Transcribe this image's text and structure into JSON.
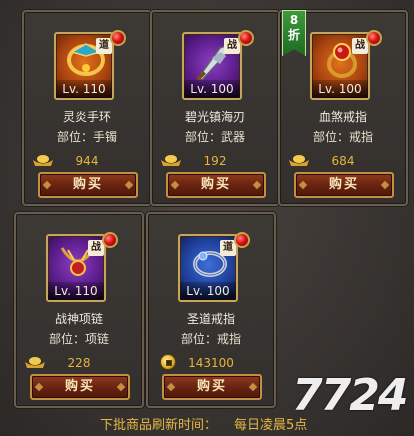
{
  "shop": {
    "items": [
      {
        "name": "灵炎手环",
        "level": "Lv. 110",
        "slot": "部位：手镯",
        "price": "944",
        "currency": "gold-ingot",
        "badge": "道",
        "frame": "orange",
        "buy_label": "购买"
      },
      {
        "name": "碧光镇海刃",
        "level": "Lv. 100",
        "slot": "部位：武器",
        "price": "192",
        "currency": "gold-ingot",
        "badge": "战",
        "frame": "purple",
        "buy_label": "购买"
      },
      {
        "name": "血煞戒指",
        "level": "Lv. 100",
        "slot": "部位：戒指",
        "price": "684",
        "currency": "gold-ingot",
        "badge": "战",
        "frame": "orange",
        "buy_label": "购买",
        "discount": "8\n折"
      },
      {
        "name": "战神项链",
        "level": "Lv. 110",
        "slot": "部位：项链",
        "price": "228",
        "currency": "gold-ingot",
        "badge": "战",
        "frame": "purple",
        "buy_label": "购买"
      },
      {
        "name": "圣道戒指",
        "level": "Lv. 100",
        "slot": "部位：戒指",
        "price": "143100",
        "currency": "gold-coin",
        "badge": "道",
        "frame": "blue",
        "buy_label": "购买"
      }
    ],
    "refresh_label": "下批商品刷新时间：",
    "refresh_value": "每日凌晨5点"
  },
  "watermark": "7724",
  "colors": {
    "price": "#e9b43c",
    "accent_gold": "#c9a55c",
    "button_red": "#6a2411",
    "discount_green": "#2e8a34"
  }
}
